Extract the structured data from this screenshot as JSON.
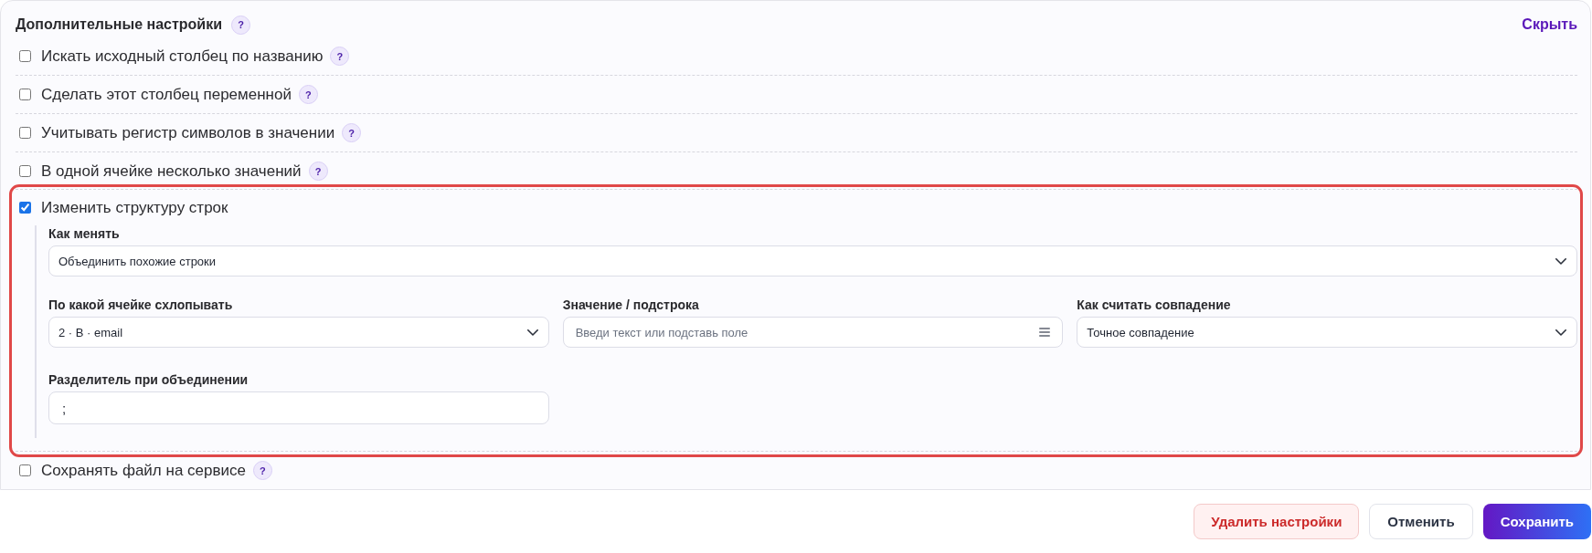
{
  "section": {
    "title": "Дополнительные настройки",
    "help": "?",
    "toggle": "Скрыть"
  },
  "options": [
    {
      "label": "Искать исходный столбец по названию",
      "checked": false,
      "help": "?",
      "highlighted": false
    },
    {
      "label": "Сделать этот столбец переменной",
      "checked": false,
      "help": "?",
      "highlighted": false
    },
    {
      "label": "Учитывать регистр символов в значении",
      "checked": false,
      "help": "?",
      "highlighted": false
    },
    {
      "label": "В одной ячейке несколько значений",
      "checked": false,
      "help": "?",
      "highlighted": false
    },
    {
      "label": "Изменить структуру строк",
      "checked": true,
      "highlighted": true,
      "details": {
        "mode": {
          "kind": "select",
          "label": "Как менять",
          "value": "Объединить похожие строки"
        },
        "fields": [
          {
            "kind": "select",
            "label": "По какой ячейке схлопывать",
            "value": "2 · B · email"
          },
          {
            "kind": "picker",
            "label": "Значение / подстрока",
            "placeholder": "Введи текст или подставь поле"
          },
          {
            "kind": "select",
            "label": "Как считать совпадение",
            "value": "Точное совпадение"
          },
          {
            "kind": "input",
            "label": "Разделитель при объединении",
            "value": ";"
          }
        ]
      }
    },
    {
      "label": "Сохранять файл на сервисе",
      "checked": false,
      "help": "?",
      "highlighted": false
    }
  ],
  "buttons": [
    {
      "label": "Удалить настройки",
      "kind": "danger"
    },
    {
      "label": "Отменить",
      "kind": "secondary"
    },
    {
      "label": "Сохранить",
      "kind": "primary"
    }
  ]
}
